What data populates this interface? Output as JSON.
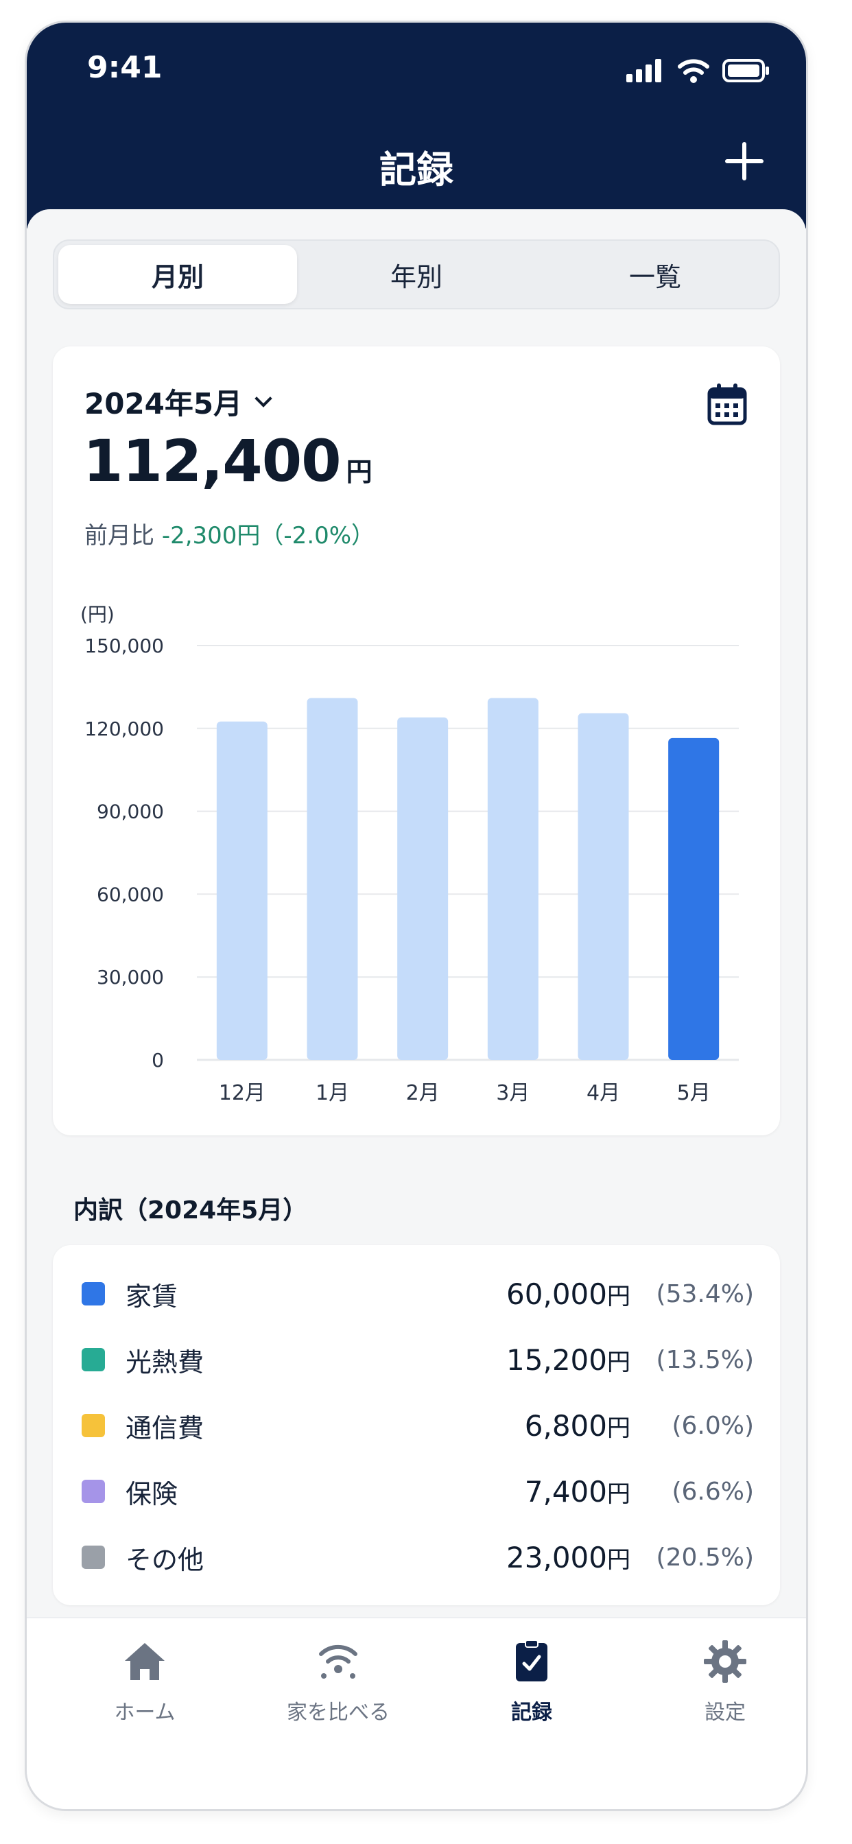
{
  "status": {
    "time": "9:41"
  },
  "header": {
    "title": "記録"
  },
  "tabs": [
    {
      "label": "月別",
      "active": true
    },
    {
      "label": "年別",
      "active": false
    },
    {
      "label": "一覧",
      "active": false
    }
  ],
  "summary": {
    "month": "2024年5月",
    "total": "112,400",
    "unit": "円",
    "compare_label": "前月比",
    "compare_value": "-2,300円（-2.0%）"
  },
  "chart_data": {
    "type": "bar",
    "ylabel": "(円)",
    "categories": [
      "12月",
      "1月",
      "2月",
      "3月",
      "4月",
      "5月"
    ],
    "values": [
      122500,
      131000,
      124000,
      131000,
      125500,
      116500
    ],
    "ylim": [
      0,
      150000
    ],
    "yticks": [
      "0",
      "30,000",
      "60,000",
      "90,000",
      "120,000",
      "150,000"
    ],
    "highlight_index": 5,
    "colors": {
      "normal": "#c5dcfa",
      "highlight": "#2f76e6",
      "grid": "#e6e8eb"
    }
  },
  "breakdown": {
    "title": "内訳（2024年5月）",
    "items": [
      {
        "name": "家賃",
        "amount": "60,000",
        "unit": "円",
        "pct": "(53.4%)",
        "color": "#2f76e6"
      },
      {
        "name": "光熱費",
        "amount": "15,200",
        "unit": "円",
        "pct": "(13.5%)",
        "color": "#27ab94"
      },
      {
        "name": "通信費",
        "amount": "6,800",
        "unit": "円",
        "pct": "(6.0%)",
        "color": "#f6c23a"
      },
      {
        "name": "保険",
        "amount": "7,400",
        "unit": "円",
        "pct": "(6.6%)",
        "color": "#a594e8"
      },
      {
        "name": "その他",
        "amount": "23,000",
        "unit": "円",
        "pct": "(20.5%)",
        "color": "#9aa0a8"
      }
    ]
  },
  "bottom_nav": [
    {
      "label": "ホーム",
      "icon": "home-icon",
      "active": false
    },
    {
      "label": "家を比べる",
      "icon": "compare-signal-icon",
      "active": false
    },
    {
      "label": "記録",
      "icon": "record-icon",
      "active": true
    },
    {
      "label": "設定",
      "icon": "gear-icon",
      "active": false
    }
  ]
}
